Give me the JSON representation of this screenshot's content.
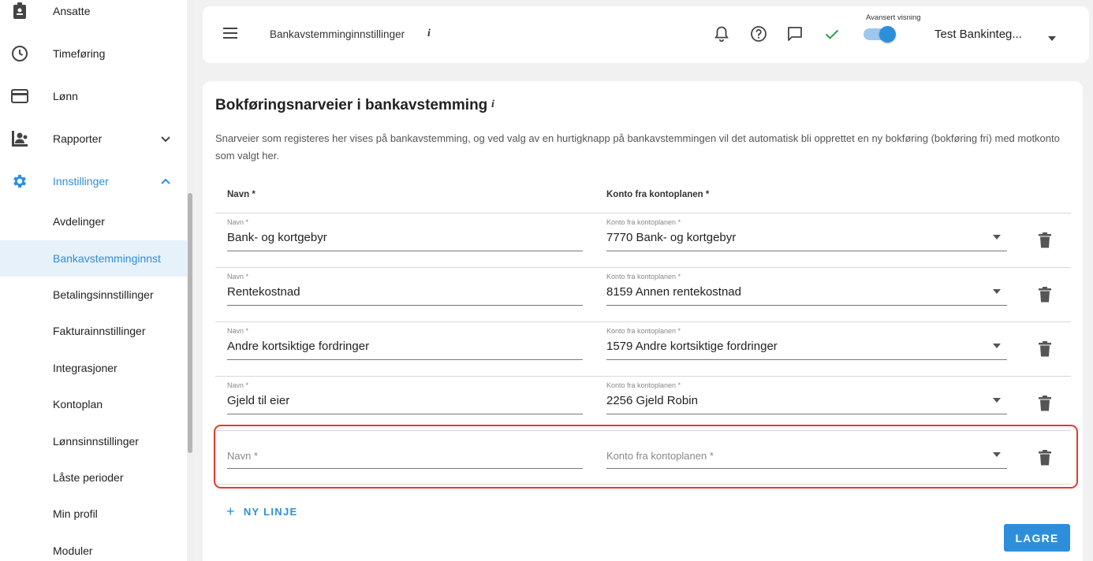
{
  "sidebar": {
    "items": [
      {
        "label": "Ansatte",
        "icon": "badge-icon"
      },
      {
        "label": "Timeføring",
        "icon": "clock-icon"
      },
      {
        "label": "Lønn",
        "icon": "credit-card-icon"
      },
      {
        "label": "Rapporter",
        "icon": "report-icon"
      },
      {
        "label": "Innstillinger",
        "icon": "gear-icon"
      }
    ],
    "subitems": [
      {
        "label": "Avdelinger"
      },
      {
        "label": "Bankavstemminginnst"
      },
      {
        "label": "Betalingsinnstillinger"
      },
      {
        "label": "Fakturainnstillinger"
      },
      {
        "label": "Integrasjoner"
      },
      {
        "label": "Kontoplan"
      },
      {
        "label": "Lønnsinnstillinger"
      },
      {
        "label": "Låste perioder"
      },
      {
        "label": "Min profil"
      },
      {
        "label": "Moduler"
      }
    ]
  },
  "header": {
    "title": "Bankavstemminginnstillinger",
    "info": "i",
    "advanced_label": "Avansert visning",
    "company": "Test Bankinteg..."
  },
  "main": {
    "title": "Bokføringsnarveier i bankavstemming",
    "info": "i",
    "description": "Snarveier som registeres her vises på bankavstemming, og ved valg av en hurtigknapp på bankavstemmingen vil det automatisk bli opprettet en ny bokføring (bokføring fri) med motkonto som valgt her.",
    "col_name": "Navn *",
    "col_account": "Konto fra kontoplanen *",
    "rows": [
      {
        "name_label": "Navn *",
        "name": "Bank- og kortgebyr",
        "account_label": "Konto fra kontoplanen *",
        "account": "7770 Bank- og kortgebyr"
      },
      {
        "name_label": "Navn *",
        "name": "Rentekostnad",
        "account_label": "Konto fra kontoplanen *",
        "account": "8159 Annen rentekostnad"
      },
      {
        "name_label": "Navn *",
        "name": "Andre kortsiktige fordringer",
        "account_label": "Konto fra kontoplanen *",
        "account": "1579 Andre kortsiktige fordringer"
      },
      {
        "name_label": "Navn *",
        "name": "Gjeld til eier",
        "account_label": "Konto fra kontoplanen *",
        "account": "2256 Gjeld Robin"
      }
    ],
    "empty_row": {
      "name_placeholder": "Navn *",
      "account_placeholder": "Konto fra kontoplanen *"
    },
    "new_line": "NY LINJE",
    "new_line_icon": "+",
    "save": "LAGRE"
  },
  "colors": {
    "accent": "#2d8fdc",
    "highlight": "#e23b2e",
    "check": "#2ea043"
  }
}
